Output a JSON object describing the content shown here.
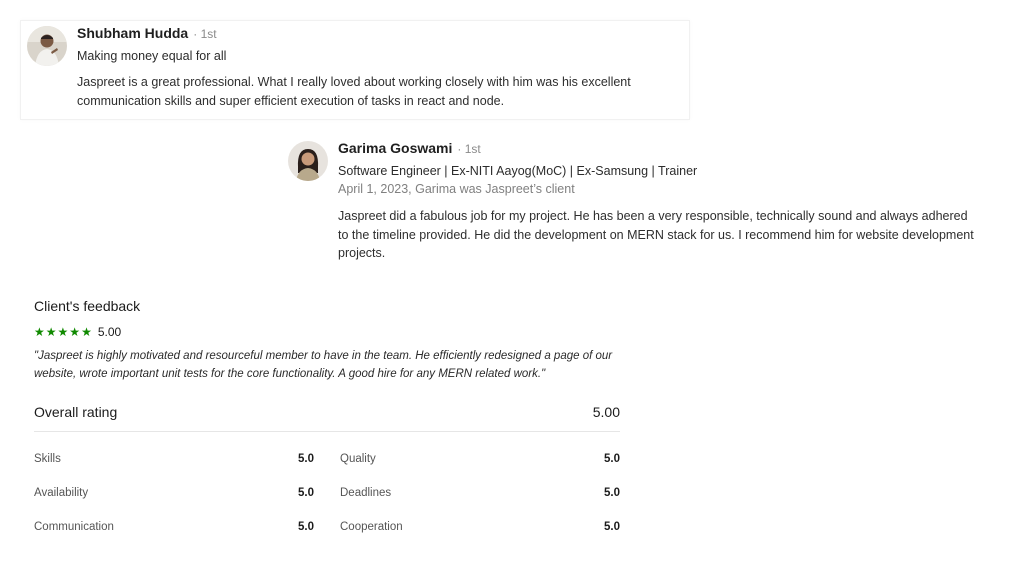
{
  "recommendations": [
    {
      "name": "Shubham Hudda",
      "degree": "· 1st",
      "headline": "Making money equal for all",
      "text": "Jaspreet is a great professional. What I really loved about working closely with him was his excellent communication skills and super efficient execution of tasks in react and node."
    },
    {
      "name": "Garima Goswami",
      "degree": "· 1st",
      "headline": "Software Engineer | Ex-NITI Aayog(MoC) | Ex-Samsung | Trainer",
      "date": "April 1, 2023, Garima was Jaspreet’s client",
      "text": "Jaspreet did a fabulous job for my project. He has been a very responsible, technically sound and always adhered to the timeline provided. He did the development on MERN stack for us. I recommend him for website development projects."
    }
  ],
  "feedback": {
    "title": "Client's feedback",
    "stars": 5,
    "score": "5.00",
    "quote": "\"Jaspreet is highly motivated and resourceful member to have in the team. He efficiently redesigned a page of our website, wrote important unit tests for the core functionality. A good hire for any MERN related work.\"",
    "overall_label": "Overall rating",
    "overall_value": "5.00",
    "sub_ratings": [
      {
        "label": "Skills",
        "value": "5.0"
      },
      {
        "label": "Quality",
        "value": "5.0"
      },
      {
        "label": "Availability",
        "value": "5.0"
      },
      {
        "label": "Deadlines",
        "value": "5.0"
      },
      {
        "label": "Communication",
        "value": "5.0"
      },
      {
        "label": "Cooperation",
        "value": "5.0"
      }
    ]
  },
  "colors": {
    "star": "#108a00",
    "muted": "#8a8a8a"
  },
  "icons": [
    "avatar-shubham",
    "avatar-garima",
    "star-icon"
  ]
}
